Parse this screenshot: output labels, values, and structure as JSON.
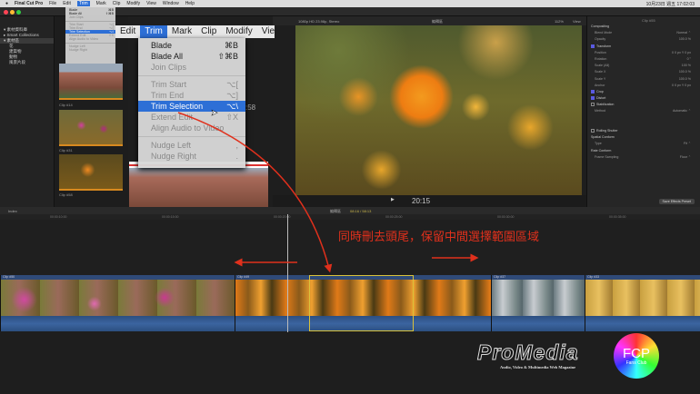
{
  "menubar": {
    "app": "Final Cut Pro",
    "items": [
      "File",
      "Edit",
      "Trim",
      "Mark",
      "Clip",
      "Modify",
      "View",
      "Window",
      "Help"
    ],
    "active": "Trim",
    "clock": "10月23日 週五  17:02:03"
  },
  "sidebar": {
    "items": [
      {
        "label": "▾ 素材資料庫"
      },
      {
        "label": "▸ Smart Collections"
      },
      {
        "label": "▾ 素材區",
        "selected": true
      },
      {
        "label": "花"
      },
      {
        "label": "建築物"
      },
      {
        "label": "動物"
      },
      {
        "label": "風景片段"
      }
    ]
  },
  "browser": {
    "filter": "All Clips",
    "clips": [
      {
        "label": "Clip #14"
      },
      {
        "label": "Clip #31"
      },
      {
        "label": "Clip #58"
      }
    ]
  },
  "zoomed_menu": {
    "bar": [
      "Edit",
      "Trim",
      "Mark",
      "Clip",
      "Modify",
      "Vie"
    ],
    "active": "Trim",
    "partial_timecode": ":58",
    "items": [
      {
        "label": "Blade",
        "shortcut": "⌘B",
        "enabled": true
      },
      {
        "label": "Blade All",
        "shortcut": "⇧⌘B",
        "enabled": true
      },
      {
        "label": "Join Clips",
        "shortcut": "",
        "enabled": false
      },
      {
        "sep": true
      },
      {
        "label": "Trim Start",
        "shortcut": "⌥[",
        "enabled": false
      },
      {
        "label": "Trim End",
        "shortcut": "⌥]",
        "enabled": false
      },
      {
        "label": "Trim Selection",
        "shortcut": "⌥\\",
        "enabled": true,
        "selected": true
      },
      {
        "label": "Extend Edit",
        "shortcut": "⇧X",
        "enabled": false
      },
      {
        "label": "Align Audio to Video",
        "shortcut": "",
        "enabled": false
      },
      {
        "sep": true
      },
      {
        "label": "Nudge Left",
        "shortcut": ",",
        "enabled": false
      },
      {
        "label": "Nudge Right",
        "shortcut": ".",
        "enabled": false
      }
    ]
  },
  "viewer": {
    "format": "1080p HD 23.98p, Stereo",
    "title": "編輯區",
    "zoom": "112%",
    "view": "View",
    "timecode": "20:15"
  },
  "inspector": {
    "title": "Clip #55",
    "rows": [
      {
        "label": "Compositing",
        "value": "",
        "header": true
      },
      {
        "label": "Blend Mode",
        "value": "Normal ⌃"
      },
      {
        "label": "Opacity",
        "value": "100.0 %"
      },
      {
        "label": "Transform",
        "value": "",
        "header": true,
        "checked": true
      },
      {
        "label": "Position",
        "value": "X 0 px   Y 0 px"
      },
      {
        "label": "Rotation",
        "value": "0 °"
      },
      {
        "label": "Scale (All)",
        "value": "100 %"
      },
      {
        "label": "Scale X",
        "value": "100.0 %"
      },
      {
        "label": "Scale Y",
        "value": "100.0 %"
      },
      {
        "label": "Anchor",
        "value": "X 0 px   Y 0 px"
      },
      {
        "label": "Crop",
        "value": "",
        "header": true,
        "checked": true
      },
      {
        "label": "Distort",
        "value": "",
        "header": true,
        "checked": true
      },
      {
        "label": "Stabilization",
        "value": "",
        "header": true,
        "checked": false
      },
      {
        "label": "Method",
        "value": "Automatic ⌃"
      },
      {
        "label": "",
        "value": ""
      },
      {
        "label": "",
        "value": ""
      },
      {
        "label": "Rolling Shutter",
        "value": "",
        "header": true,
        "checked": false
      },
      {
        "label": "Spatial Conform",
        "value": "",
        "header": true
      },
      {
        "label": "Type",
        "value": "Fit ⌃"
      },
      {
        "label": "Rate Conform",
        "value": "",
        "header": true
      },
      {
        "label": "Frame Sampling",
        "value": "Floor ⌃"
      }
    ],
    "save_preset": "Save Effects Preset"
  },
  "timeline": {
    "index": "Index",
    "project": "編輯區",
    "duration": "08:16 / 58:13",
    "ruler": [
      "00:00:10:00",
      "00:00:15:00",
      "00:00:20:00",
      "00:00:25:00",
      "00:00:30:00",
      "00:00:35:00"
    ],
    "clips": [
      {
        "label": "Clip #50",
        "kind": "pink"
      },
      {
        "label": "Clip #49",
        "kind": "orange"
      },
      {
        "label": "Clip #37",
        "kind": "gray"
      },
      {
        "label": "Clip #33",
        "kind": "yellow"
      }
    ]
  },
  "annotation": {
    "text": "同時刪去頭尾，保留中間選擇範圍區域",
    "color": "#e0301c"
  },
  "logos": {
    "promedia": "ProMedia",
    "promedia_sub": "Audio, Video & Multimedia Web Magazine",
    "fcp": "FCP",
    "fcp_sub": "Fans Club"
  }
}
